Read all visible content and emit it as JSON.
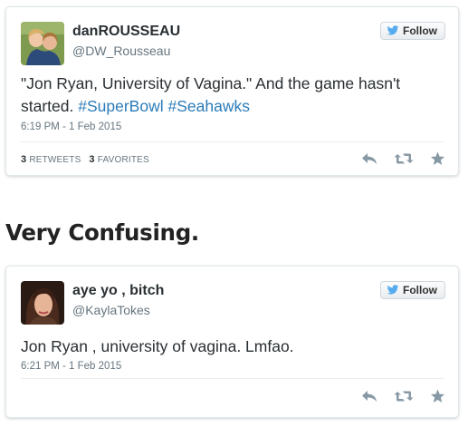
{
  "tweets": [
    {
      "display_name": "danROUSSEAU",
      "handle": "@DW_Rousseau",
      "follow_label": "Follow",
      "text_plain": "\"Jon Ryan, University of Vagina.\" And the game hasn't started. ",
      "hashtags": [
        "#SuperBowl",
        "#Seahawks"
      ],
      "timestamp": "6:19 PM - 1 Feb 2015",
      "retweets_count": "3",
      "retweets_label": "RETWEETS",
      "favorites_count": "3",
      "favorites_label": "FAVORITES"
    },
    {
      "display_name": "aye yo , bitch",
      "handle": "@KaylaTokes",
      "follow_label": "Follow",
      "text_plain": "Jon Ryan , university of vagina. Lmfao.",
      "timestamp": "6:21 PM - 1 Feb 2015"
    }
  ],
  "heading": "Very Confusing.",
  "icons": {
    "reply": "reply-icon",
    "retweet": "retweet-icon",
    "favorite": "star-icon",
    "follow": "twitter-bird-icon"
  },
  "colors": {
    "hashtag": "#2b7bb9",
    "twitter_blue": "#55acee",
    "action_gray": "#8899a6"
  }
}
